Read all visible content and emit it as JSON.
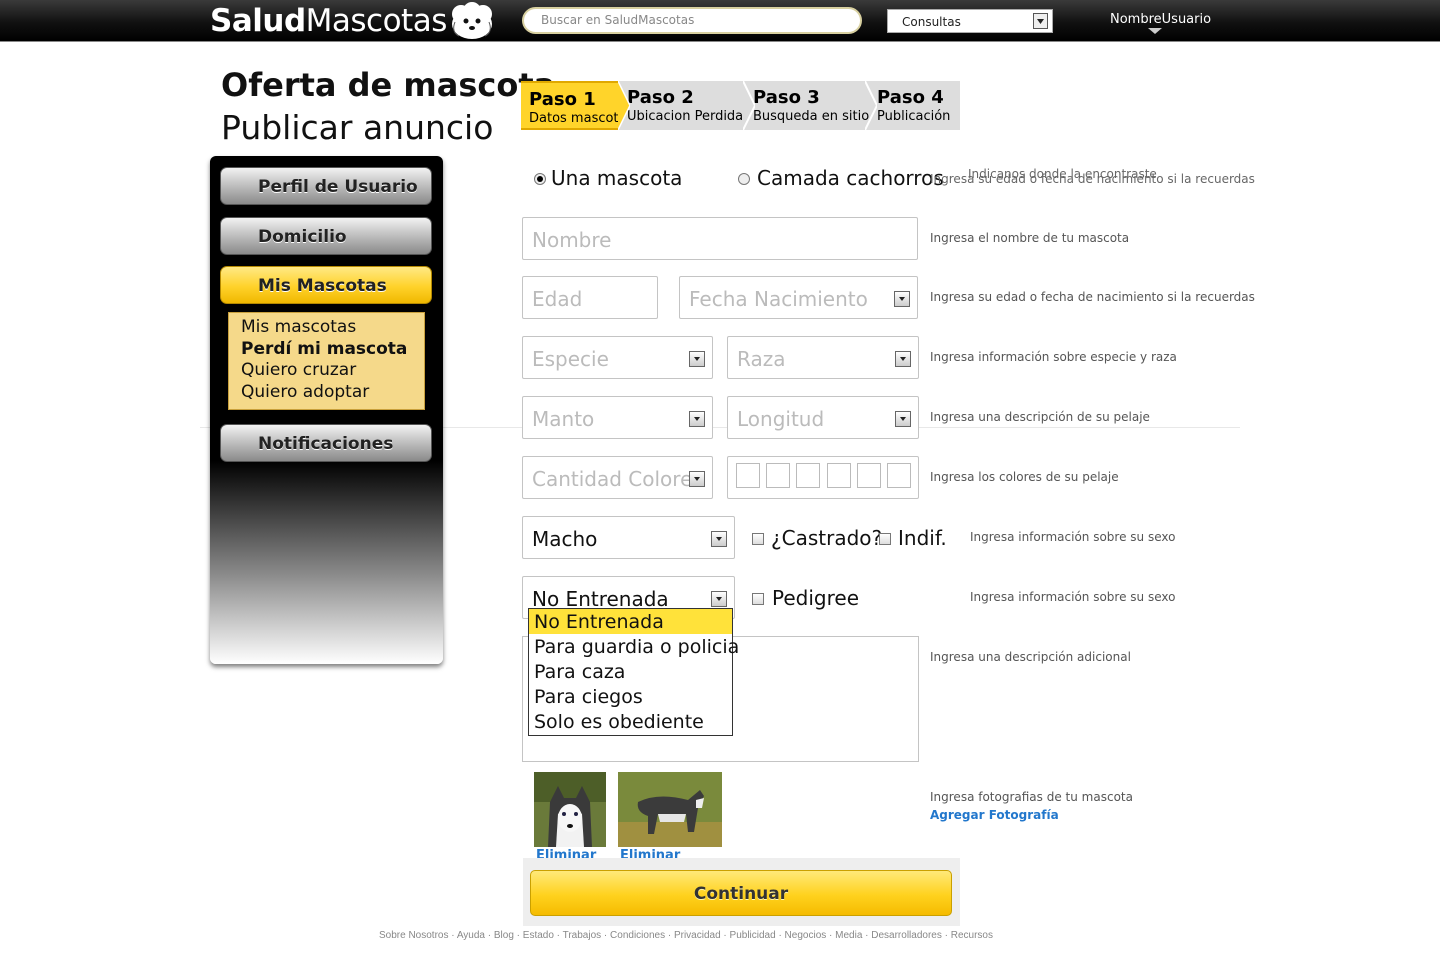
{
  "header": {
    "logo_bold": "Salud",
    "logo_regular": "Mascotas",
    "search_placeholder": "Buscar en SaludMascotas",
    "category_select": "Consultas",
    "username": "NombreUsuario"
  },
  "page": {
    "title": "Oferta de mascota",
    "subtitle": "Publicar anuncio"
  },
  "steps": [
    {
      "num": "Paso 1",
      "label": "Datos mascota",
      "active": true
    },
    {
      "num": "Paso 2",
      "label": "Ubicacion Perdida",
      "active": false
    },
    {
      "num": "Paso 3",
      "label": "Busqueda en sitio",
      "active": false
    },
    {
      "num": "Paso 4",
      "label": "Publicación",
      "active": false
    }
  ],
  "sidebar": {
    "items": [
      "Perfil de Usuario",
      "Domicilio",
      "Mis Mascotas",
      "Notificaciones"
    ],
    "submenu": [
      "Mis mascotas",
      "Perdí mi mascota",
      "Quiero cruzar",
      "Quiero adoptar"
    ]
  },
  "form": {
    "type_single": "Una mascota",
    "type_litter": "Camada cachorros",
    "hint_type_a": "Indicanos donde la encontraste",
    "hint_type_b": "Ingresa su edad o fecha de nacimiento si la recuerdas",
    "name_placeholder": "Nombre",
    "hint_name": "Ingresa el nombre de tu mascota",
    "age_placeholder": "Edad",
    "birth_placeholder": "Fecha Nacimiento",
    "hint_age": "Ingresa su edad o fecha de nacimiento si la recuerdas",
    "species_placeholder": "Especie",
    "breed_placeholder": "Raza",
    "hint_species": "Ingresa información sobre especie y raza",
    "coat_placeholder": "Manto",
    "length_placeholder": "Longitud",
    "hint_coat": "Ingresa una descripción de su pelaje",
    "colors_placeholder": "Cantidad Colores",
    "hint_colors": "Ingresa los colores de su pelaje",
    "sex_value": "Macho",
    "neutered_label": "¿Castrado?",
    "indif_label": "Indif.",
    "hint_sex": "Ingresa información sobre su sexo",
    "training_value": "No Entrenada",
    "pedigree_label": "Pedigree",
    "hint_training": "Ingresa información sobre su sexo",
    "training_options": [
      "No Entrenada",
      "Para guardia o policia",
      "Para caza",
      "Para ciegos",
      "Solo es obediente"
    ],
    "hint_description": "Ingresa una descripción adicional",
    "hint_photos": "Ingresa fotografias de tu mascota",
    "add_photo": "Agregar Fotografía",
    "remove_label": "Eliminar",
    "continue": "Continuar"
  },
  "footer": "Sobre Nosotros · Ayuda · Blog · Estado · Trabajos · Condiciones · Privacidad · Publicidad · Negocios · Media · Desarrolladores · Recursos",
  "colors": {
    "accent": "#ffd42a",
    "link": "#2277cc",
    "topbar": "#111111"
  }
}
